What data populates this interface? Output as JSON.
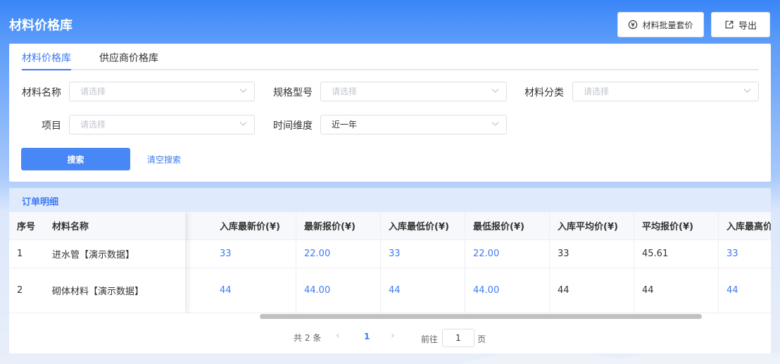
{
  "header": {
    "title": "材料价格库",
    "batch_button": "材料批量套价",
    "export_button": "导出"
  },
  "tabs": [
    {
      "label": "材料价格库",
      "active": true
    },
    {
      "label": "供应商价格库",
      "active": false
    }
  ],
  "filters": {
    "material_name": {
      "label": "材料名称",
      "placeholder": "请选择"
    },
    "spec_model": {
      "label": "规格型号",
      "placeholder": "请选择"
    },
    "material_category": {
      "label": "材料分类",
      "placeholder": "请选择"
    },
    "project": {
      "label": "项目",
      "placeholder": "请选择"
    },
    "time_dimension": {
      "label": "时间维度",
      "value": "近一年"
    }
  },
  "actions": {
    "search": "搜索",
    "clear": "清空搜索"
  },
  "section": {
    "title": "订单明细"
  },
  "table": {
    "columns": [
      "序号",
      "材料名称",
      "入库最新价(¥)",
      "最新报价(¥)",
      "入库最低价(¥)",
      "最低报价(¥)",
      "入库平均价(¥)",
      "平均报价(¥)",
      "入库最高价(¥)"
    ],
    "rows": [
      [
        "1",
        "进水管【演示数据】",
        "33",
        "22.00",
        "33",
        "22.00",
        "33",
        "45.61",
        "33"
      ],
      [
        "2",
        "砌体材料【演示数据】",
        "44",
        "44.00",
        "44",
        "44.00",
        "44",
        "44",
        "44"
      ]
    ]
  },
  "pagination": {
    "total": "共 2 条",
    "current_page": "1",
    "goto_label": "前往",
    "goto_value": "1",
    "page_suffix": "页"
  },
  "colors": {
    "accent": "#3c7af3",
    "primary_button": "#4787f6",
    "header_gradient_top": "#3a86f8"
  },
  "icons": {
    "batch": "price-tag-icon",
    "export": "export-icon",
    "dropdown": "chevron-down-icon",
    "prev": "chevron-left-icon",
    "next": "chevron-right-icon"
  }
}
